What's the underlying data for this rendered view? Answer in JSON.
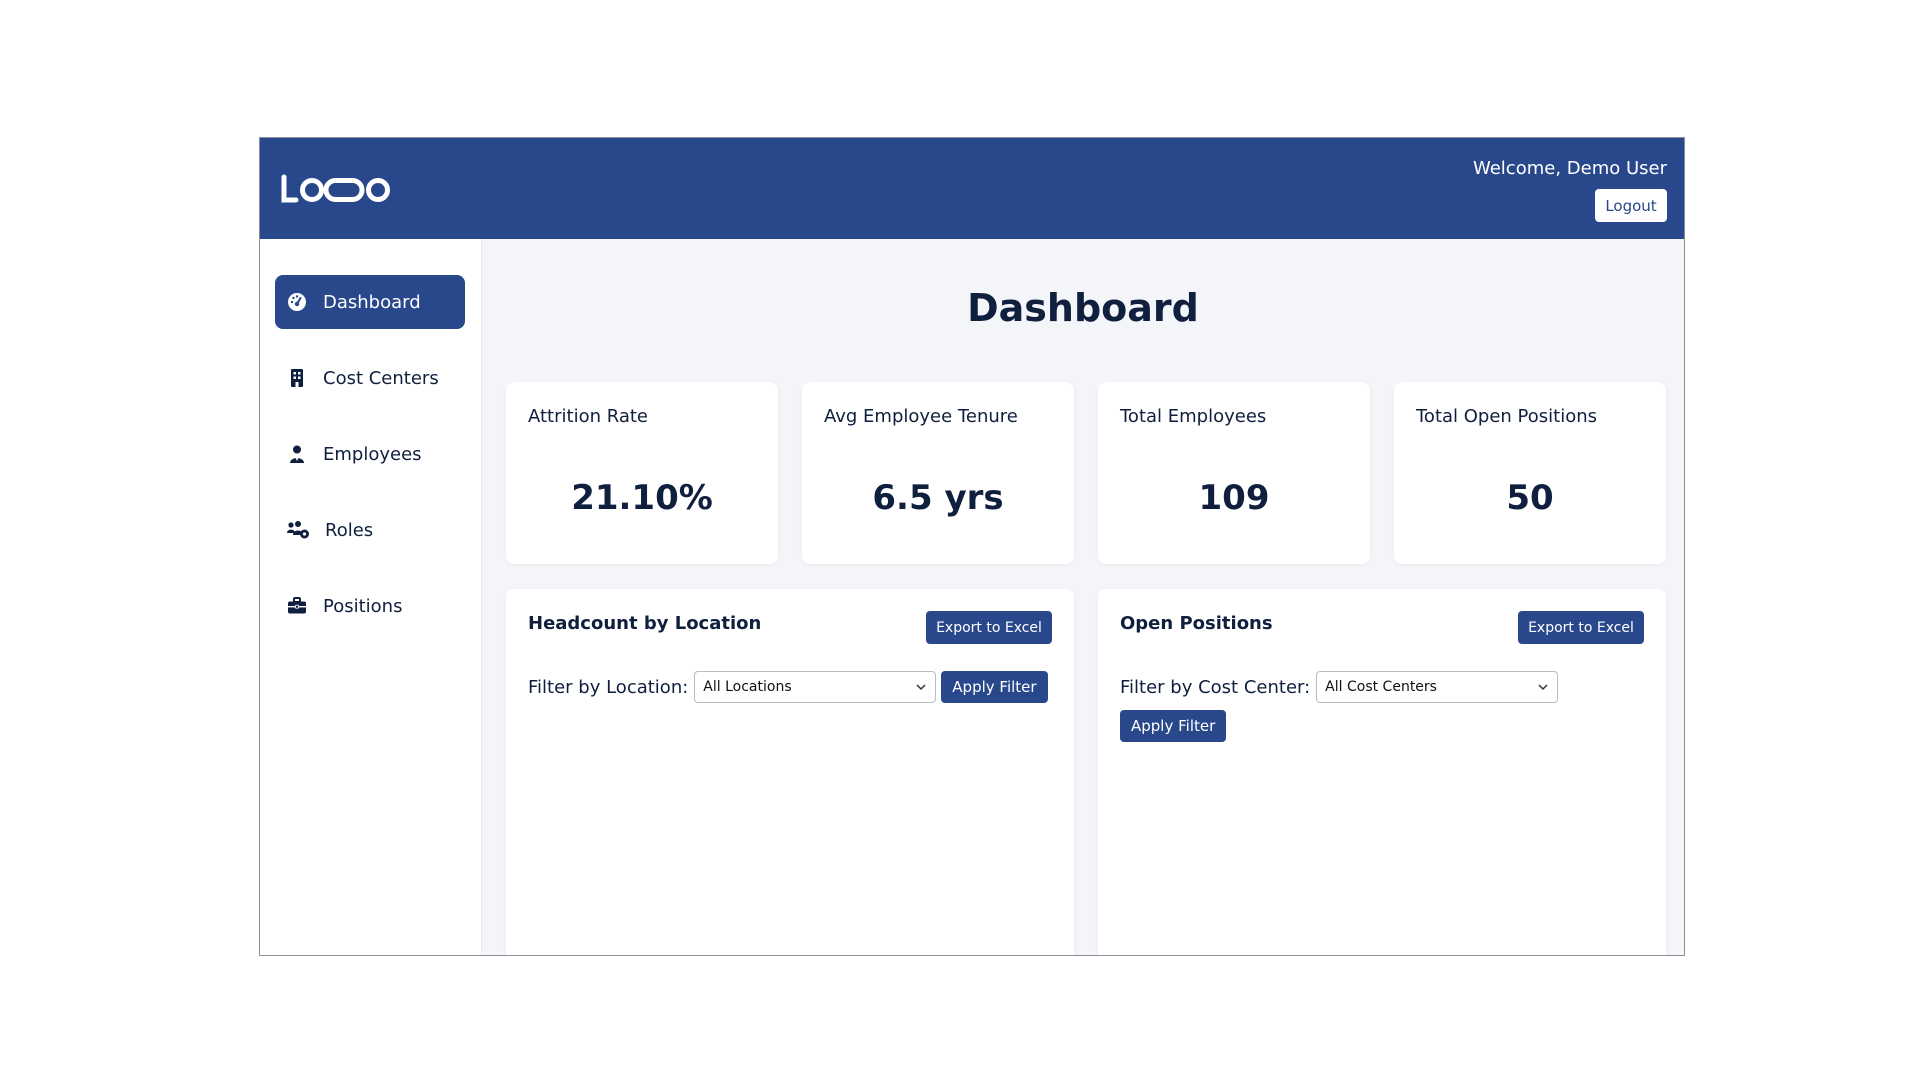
{
  "header": {
    "logo_text": "LOGO",
    "welcome": "Welcome, Demo User",
    "logout_label": "Logout"
  },
  "sidebar": {
    "items": [
      {
        "label": "Dashboard",
        "icon": "dashboard-icon",
        "active": true
      },
      {
        "label": "Cost Centers",
        "icon": "building-icon",
        "active": false
      },
      {
        "label": "Employees",
        "icon": "user-icon",
        "active": false
      },
      {
        "label": "Roles",
        "icon": "users-gear-icon",
        "active": false
      },
      {
        "label": "Positions",
        "icon": "briefcase-icon",
        "active": false
      }
    ]
  },
  "main": {
    "title": "Dashboard",
    "kpis": [
      {
        "label": "Attrition Rate",
        "value": "21.10%"
      },
      {
        "label": "Avg Employee Tenure",
        "value": "6.5 yrs"
      },
      {
        "label": "Total Employees",
        "value": "109"
      },
      {
        "label": "Total Open Positions",
        "value": "50"
      }
    ],
    "panels": [
      {
        "title": "Headcount by Location",
        "export_label": "Export to Excel",
        "filter_label": "Filter by Location:",
        "filter_value": "All Locations",
        "apply_label": "Apply Filter"
      },
      {
        "title": "Open Positions",
        "export_label": "Export to Excel",
        "filter_label": "Filter by Cost Center:",
        "filter_value": "All Cost Centers",
        "apply_label": "Apply Filter"
      }
    ]
  },
  "colors": {
    "brand": "#29488b",
    "text": "#0f1f3d",
    "background": "#f3f5f8"
  }
}
